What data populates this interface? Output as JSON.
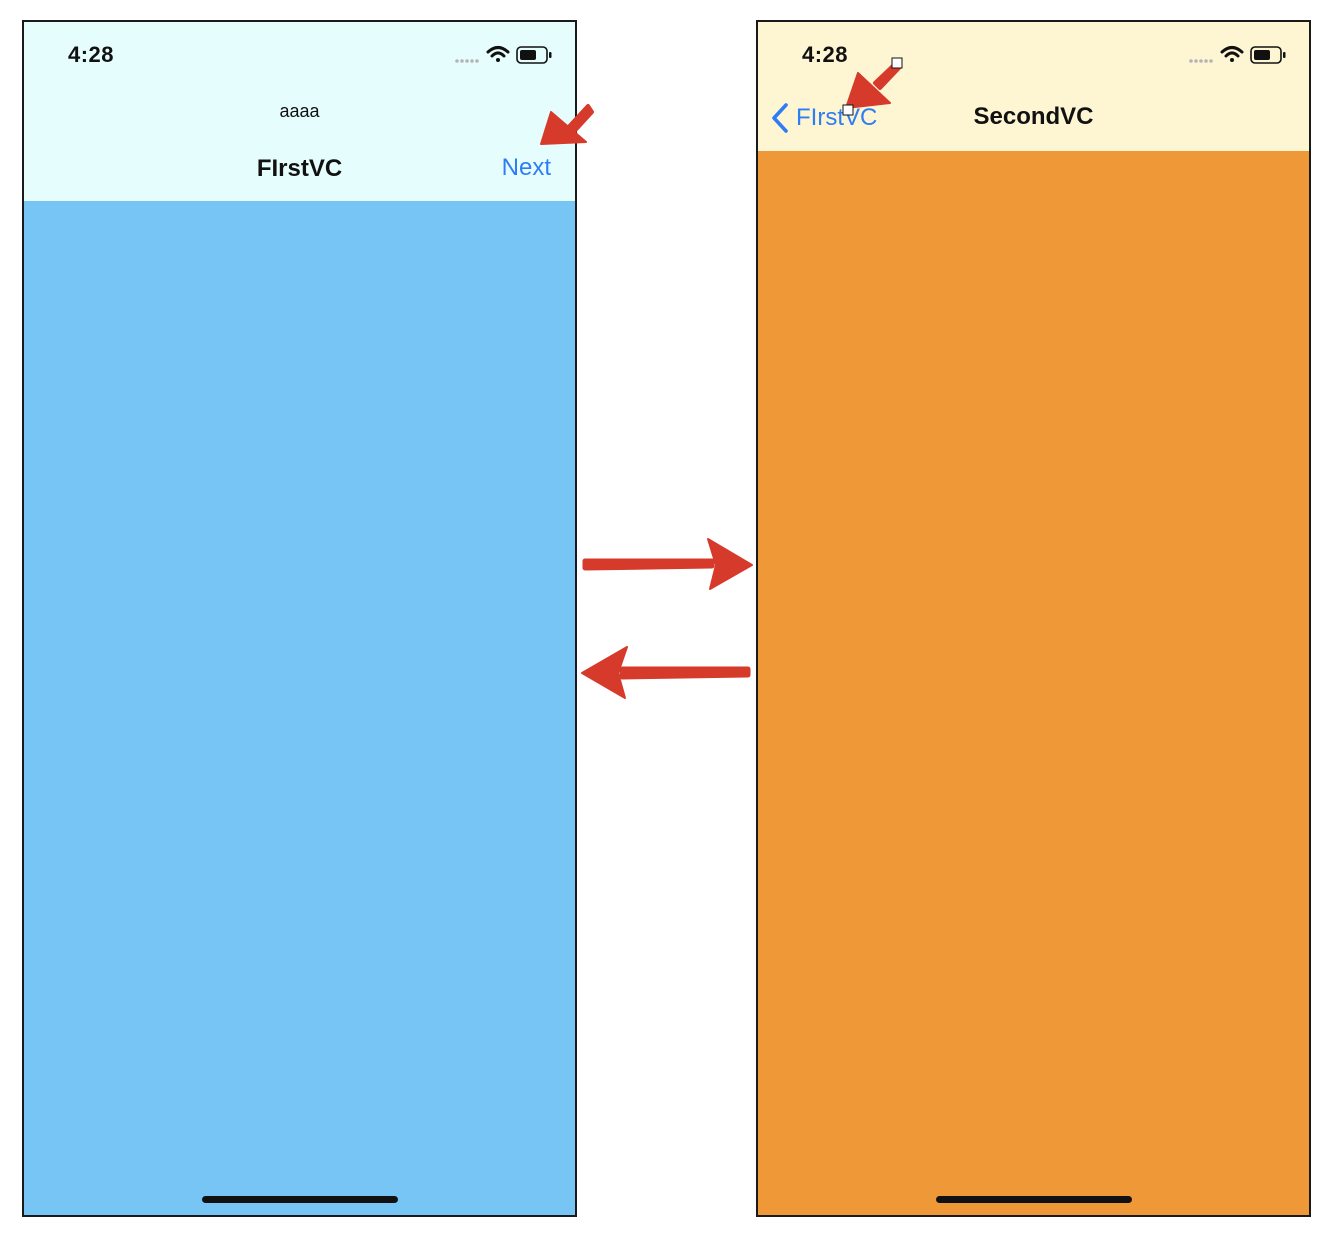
{
  "first_vc": {
    "status_time": "4:28",
    "prompt": "aaaa",
    "title": "FIrstVC",
    "next_label": "Next"
  },
  "second_vc": {
    "status_time": "4:28",
    "back_label": "FIrstVC",
    "title": "SecondVC"
  },
  "colors": {
    "first_content": "#76c5f4",
    "first_navbar": "#e6fdfe",
    "second_content": "#ef9837",
    "second_navbar": "#fef5d3",
    "tint": "#2f7df5",
    "annotation": "#d63a2a"
  },
  "icons": [
    "signal-dots-icon",
    "wifi-icon",
    "battery-icon",
    "chevron-left-icon"
  ]
}
